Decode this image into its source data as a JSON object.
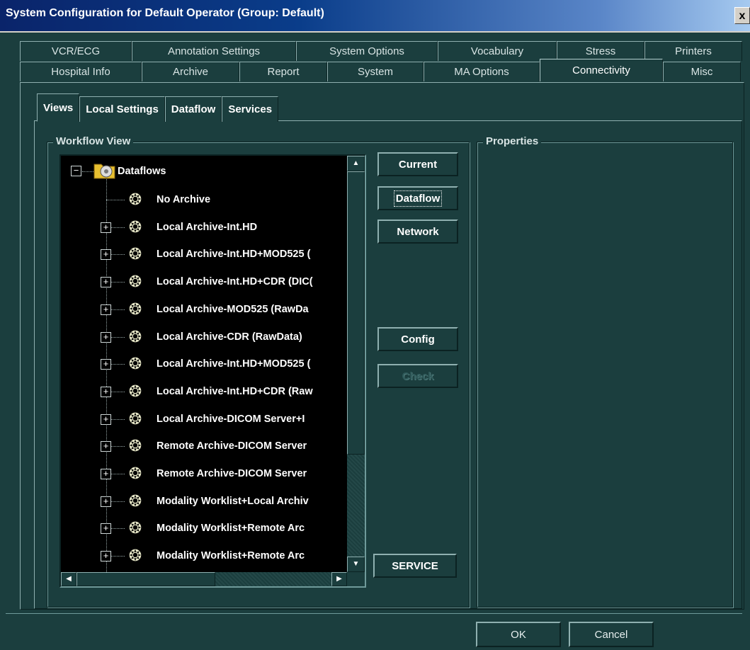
{
  "window": {
    "title": "System Configuration for Default Operator (Group: Default)",
    "close_label": "x"
  },
  "tabs_row1": [
    "VCR/ECG",
    "Annotation Settings",
    "System Options",
    "Vocabulary",
    "Stress",
    "Printers"
  ],
  "tabs_row2": [
    "Hospital Info",
    "Archive",
    "Report",
    "System",
    "MA Options",
    "Connectivity",
    "Misc"
  ],
  "active_tab": "Connectivity",
  "subtabs": [
    "Views",
    "Local Settings",
    "Dataflow",
    "Services"
  ],
  "active_subtab": "Views",
  "workflow_view": {
    "legend": "Workflow View",
    "root": "Dataflows",
    "items": [
      "No Archive",
      "Local Archive-Int.HD",
      "Local Archive-Int.HD+MOD525 (",
      "Local Archive-Int.HD+CDR (DIC(",
      "Local Archive-MOD525 (RawDa",
      "Local Archive-CDR (RawData)",
      "Local Archive-Int.HD+MOD525 (",
      "Local Archive-Int.HD+CDR (Raw",
      "Local Archive-DICOM Server+I",
      "Remote Archive-DICOM Server",
      "Remote Archive-DICOM Server",
      "Modality Worklist+Local Archiv",
      "Modality Worklist+Remote Arc",
      "Modality Worklist+Remote Arc"
    ]
  },
  "buttons": {
    "current": "Current",
    "dataflow": "Dataflow",
    "network": "Network",
    "config": "Config",
    "check": "Check",
    "service": "SERVICE"
  },
  "properties": {
    "legend": "Properties"
  },
  "footer": {
    "ok": "OK",
    "cancel": "Cancel"
  }
}
